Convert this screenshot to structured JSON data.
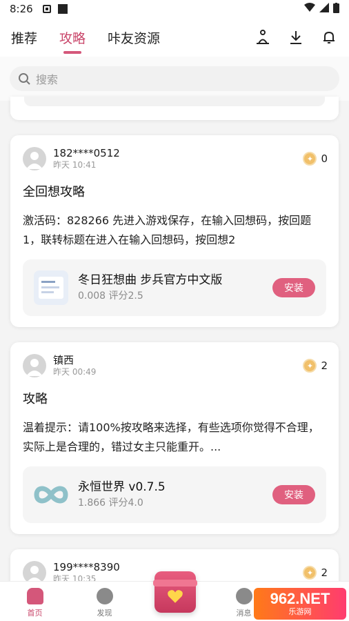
{
  "status": {
    "time": "8:26"
  },
  "tabs": [
    "推荐",
    "攻略",
    "咔友资源"
  ],
  "search": {
    "placeholder": "搜索"
  },
  "posts": [
    {
      "user": "182****0512",
      "time": "昨天 10:41",
      "likes": "0",
      "title": "全回想攻略",
      "body": "激活码：828266 先进入游戏保存，在输入回想码，按回题1，联转标题在进入在输入回想码，按回想2",
      "game": {
        "name": "冬日狂想曲 步兵官方中文版",
        "meta": "0.008  评分2.5",
        "install": "安装"
      }
    },
    {
      "user": "镇西",
      "time": "昨天 00:49",
      "likes": "2",
      "title": "攻略",
      "body": "温着提示：请100%按攻略来选择，有些选项你觉得不合理，实际上是合理的，错过女主只能重开。...",
      "game": {
        "name": "永恒世界 v0.7.5",
        "meta": "1.866  评分4.0",
        "install": "安装"
      }
    },
    {
      "user": "199****8390",
      "time": "昨天 10:35",
      "likes": "2"
    }
  ],
  "bottom_nav": {
    "home": "首页",
    "discover": "发现",
    "messages": "消息"
  },
  "watermark": {
    "brand": "962.NET",
    "sub": "乐游网"
  },
  "colors": {
    "accent": "#c9466a",
    "install": "#e0607f"
  }
}
